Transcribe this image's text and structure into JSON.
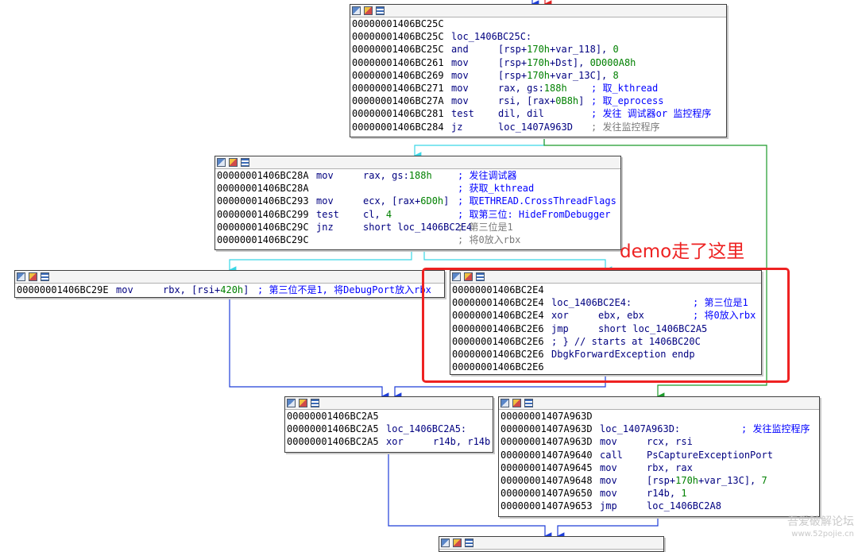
{
  "annotation": {
    "text": "demo走了这里",
    "color": "#ee2222"
  },
  "watermark": {
    "line1": "吾爱破解论坛",
    "line2": "www.52pojie.cn"
  },
  "colors": {
    "edge_blue": "#1e3ed8",
    "edge_cyan": "#3ad7e6",
    "edge_green": "#1c9a2a",
    "edge_red": "#e02020"
  },
  "toolbar_icons": [
    "graph-view-icon",
    "color-edit-icon",
    "text-view-icon"
  ],
  "blocks": {
    "b1": {
      "lines": [
        {
          "addr": "00000001406BC25C"
        },
        {
          "addr": "00000001406BC25C",
          "label": "loc_1406BC25C:"
        },
        {
          "addr": "00000001406BC25C",
          "mn": "and",
          "op": "[rsp+170h+var_118], 0"
        },
        {
          "addr": "00000001406BC261",
          "mn": "mov",
          "op": "[rsp+170h+Dst], 0D000A8h"
        },
        {
          "addr": "00000001406BC269",
          "mn": "mov",
          "op": "[rsp+170h+var_13C], 8"
        },
        {
          "addr": "00000001406BC271",
          "mn": "mov",
          "op": "rax, gs:188h",
          "cm": "; 取_kthread"
        },
        {
          "addr": "00000001406BC27A",
          "mn": "mov",
          "op": "rsi, [rax+0B8h]",
          "cm": "; 取_eprocess"
        },
        {
          "addr": "00000001406BC281",
          "mn": "test",
          "op": "dil, dil",
          "cm": "; 发往 调试器or 监控程序"
        },
        {
          "addr": "00000001406BC284",
          "mn": "jz",
          "op": "loc_1407A963D",
          "cm": "; 发往监控程序",
          "cm_grey": true
        }
      ]
    },
    "b2": {
      "lines": [
        {
          "addr": "00000001406BC28A",
          "mn": "mov",
          "op": "rax, gs:188h",
          "cm": "; 发往调试器"
        },
        {
          "addr": "00000001406BC28A",
          "cm": "; 获取_kthread"
        },
        {
          "addr": "00000001406BC293",
          "mn": "mov",
          "op": "ecx, [rax+6D0h]",
          "cm": "; 取ETHREAD.CrossThreadFlags"
        },
        {
          "addr": "00000001406BC299",
          "mn": "test",
          "op": "cl, 4",
          "cm": "; 取第三位: HideFromDebugger"
        },
        {
          "addr": "00000001406BC29C",
          "mn": "jnz",
          "op": "short loc_1406BC2E4",
          "cm": "; 第三位是1",
          "cm_grey": true
        },
        {
          "addr": "00000001406BC29C",
          "cm": "; 将0放入rbx",
          "cm_grey": true
        }
      ]
    },
    "b3": {
      "lines": [
        {
          "addr": "00000001406BC29E",
          "mn": "mov",
          "op": "rbx, [rsi+420h]",
          "cm": "; 第三位不是1, 将DebugPort放入rbx"
        }
      ]
    },
    "b4": {
      "lines": [
        {
          "addr": "00000001406BC2E4"
        },
        {
          "addr": "00000001406BC2E4",
          "label": "loc_1406BC2E4:",
          "cm": "; 第三位是1"
        },
        {
          "addr": "00000001406BC2E4",
          "mn": "xor",
          "op": "ebx, ebx",
          "cm": "; 将0放入rbx"
        },
        {
          "addr": "00000001406BC2E6",
          "mn": "jmp",
          "op": "short loc_1406BC2A5"
        },
        {
          "addr": "00000001406BC2E6",
          "label": "; } // starts at 1406BC20C"
        },
        {
          "addr": "00000001406BC2E6",
          "label": "DbgkForwardException endp"
        },
        {
          "addr": "00000001406BC2E6"
        }
      ]
    },
    "b5": {
      "lines": [
        {
          "addr": "00000001406BC2A5"
        },
        {
          "addr": "00000001406BC2A5",
          "label": "loc_1406BC2A5:"
        },
        {
          "addr": "00000001406BC2A5",
          "mn": "xor",
          "op": "r14b, r14b"
        }
      ]
    },
    "b6": {
      "lines": [
        {
          "addr": "00000001407A963D"
        },
        {
          "addr": "00000001407A963D",
          "label": "loc_1407A963D:",
          "cm": "; 发往监控程序"
        },
        {
          "addr": "00000001407A963D",
          "mn": "mov",
          "op": "rcx, rsi"
        },
        {
          "addr": "00000001407A9640",
          "mn": "call",
          "op": "PsCaptureExceptionPort"
        },
        {
          "addr": "00000001407A9645",
          "mn": "mov",
          "op": "rbx, rax"
        },
        {
          "addr": "00000001407A9648",
          "mn": "mov",
          "op": "[rsp+170h+var_13C], 7"
        },
        {
          "addr": "00000001407A9650",
          "mn": "mov",
          "op": "r14b, 1"
        },
        {
          "addr": "00000001407A9653",
          "mn": "jmp",
          "op": "loc_1406BC2A8"
        }
      ]
    },
    "b7": {
      "lines": []
    }
  }
}
